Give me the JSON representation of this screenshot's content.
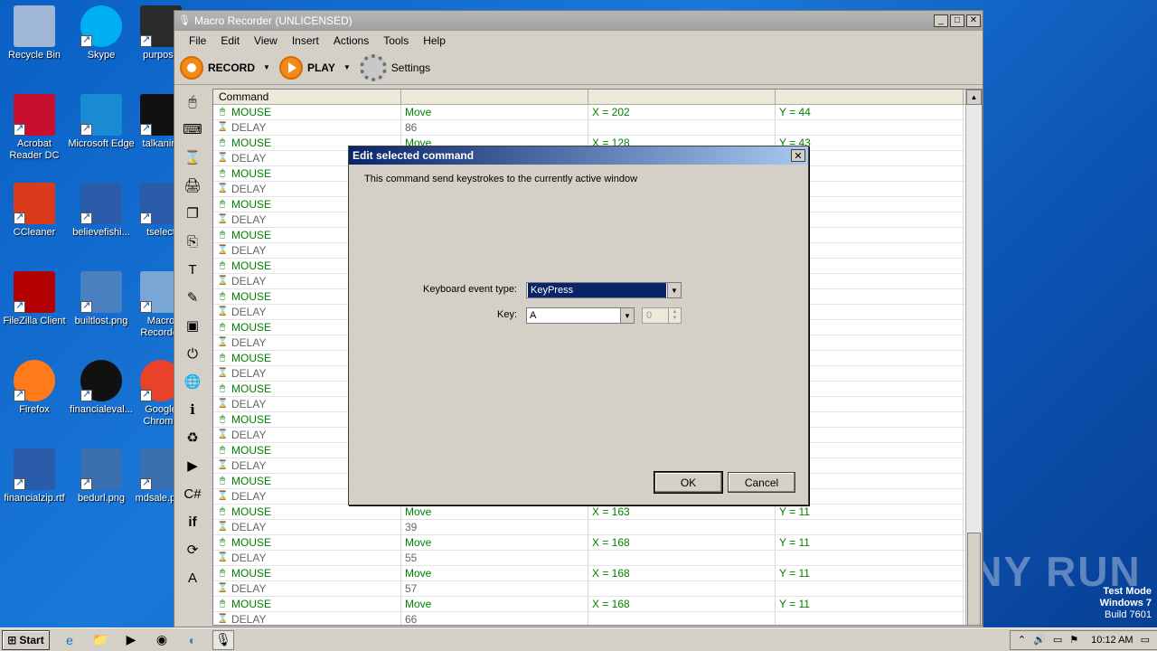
{
  "desktop_icons": [
    {
      "label": "Recycle Bin",
      "x": 0
    },
    {
      "label": "Skype"
    },
    {
      "label": "purpose"
    },
    {
      "label": "Acrobat Reader DC"
    },
    {
      "label": "Microsoft Edge"
    },
    {
      "label": "talkanim"
    },
    {
      "label": "CCleaner"
    },
    {
      "label": "believefishi..."
    },
    {
      "label": "tselect"
    },
    {
      "label": "FileZilla Client"
    },
    {
      "label": "builtlost.png"
    },
    {
      "label": "Macro Recorder"
    },
    {
      "label": "Firefox"
    },
    {
      "label": "financialeval..."
    },
    {
      "label": "Google Chrome"
    },
    {
      "label": "financialzip.rtf"
    },
    {
      "label": "bedurl.png"
    },
    {
      "label": "mdsale.png"
    }
  ],
  "window": {
    "title": "Macro Recorder (UNLICENSED)",
    "menu": [
      "File",
      "Edit",
      "View",
      "Insert",
      "Actions",
      "Tools",
      "Help"
    ],
    "toolbar": {
      "record": "RECORD",
      "play": "PLAY",
      "settings": "Settings"
    }
  },
  "table": {
    "headers": [
      "Command",
      "",
      "",
      ""
    ],
    "rows": [
      {
        "cmd": "MOUSE",
        "a": "Move",
        "b": "X = 202",
        "c": "Y = 44"
      },
      {
        "cmd": "DELAY",
        "a": "86",
        "b": "",
        "c": ""
      },
      {
        "cmd": "MOUSE",
        "a": "Move",
        "b": "X = 128",
        "c": "Y = 43"
      },
      {
        "cmd": "DELAY",
        "a": "",
        "b": "",
        "c": ""
      },
      {
        "cmd": "MOUSE",
        "a": "",
        "b": "",
        "c": ""
      },
      {
        "cmd": "DELAY",
        "a": "",
        "b": "",
        "c": ""
      },
      {
        "cmd": "MOUSE",
        "a": "",
        "b": "",
        "c": ""
      },
      {
        "cmd": "DELAY",
        "a": "",
        "b": "",
        "c": ""
      },
      {
        "cmd": "MOUSE",
        "a": "",
        "b": "",
        "c": ""
      },
      {
        "cmd": "DELAY",
        "a": "",
        "b": "",
        "c": ""
      },
      {
        "cmd": "MOUSE",
        "a": "",
        "b": "",
        "c": ""
      },
      {
        "cmd": "DELAY",
        "a": "",
        "b": "",
        "c": ""
      },
      {
        "cmd": "MOUSE",
        "a": "",
        "b": "",
        "c": ""
      },
      {
        "cmd": "DELAY",
        "a": "",
        "b": "",
        "c": ""
      },
      {
        "cmd": "MOUSE",
        "a": "",
        "b": "",
        "c": ""
      },
      {
        "cmd": "DELAY",
        "a": "",
        "b": "",
        "c": ""
      },
      {
        "cmd": "MOUSE",
        "a": "",
        "b": "",
        "c": ""
      },
      {
        "cmd": "DELAY",
        "a": "",
        "b": "",
        "c": ""
      },
      {
        "cmd": "MOUSE",
        "a": "",
        "b": "",
        "c": ""
      },
      {
        "cmd": "DELAY",
        "a": "",
        "b": "",
        "c": ""
      },
      {
        "cmd": "MOUSE",
        "a": "",
        "b": "",
        "c": ""
      },
      {
        "cmd": "DELAY",
        "a": "",
        "b": "",
        "c": ""
      },
      {
        "cmd": "MOUSE",
        "a": "",
        "b": "",
        "c": ""
      },
      {
        "cmd": "DELAY",
        "a": "",
        "b": "",
        "c": ""
      },
      {
        "cmd": "MOUSE",
        "a": "",
        "b": "",
        "c": ""
      },
      {
        "cmd": "DELAY",
        "a": "",
        "b": "",
        "c": ""
      },
      {
        "cmd": "MOUSE",
        "a": "Move",
        "b": "X = 163",
        "c": "Y = 11"
      },
      {
        "cmd": "DELAY",
        "a": "39",
        "b": "",
        "c": ""
      },
      {
        "cmd": "MOUSE",
        "a": "Move",
        "b": "X = 168",
        "c": "Y = 11"
      },
      {
        "cmd": "DELAY",
        "a": "55",
        "b": "",
        "c": ""
      },
      {
        "cmd": "MOUSE",
        "a": "Move",
        "b": "X = 168",
        "c": "Y = 11"
      },
      {
        "cmd": "DELAY",
        "a": "57",
        "b": "",
        "c": ""
      },
      {
        "cmd": "MOUSE",
        "a": "Move",
        "b": "X = 168",
        "c": "Y = 11"
      },
      {
        "cmd": "DELAY",
        "a": "66",
        "b": "",
        "c": ""
      }
    ]
  },
  "dialog": {
    "title": "Edit selected command",
    "description": "This command send keystrokes to the currently active window",
    "event_type_label": "Keyboard event type:",
    "event_type_value": "KeyPress",
    "key_label": "Key:",
    "key_value": "A",
    "count_value": "0",
    "ok": "OK",
    "cancel": "Cancel"
  },
  "taskbar": {
    "start": "Start",
    "clock": "10:12 AM"
  },
  "watermark": {
    "line1": "Test Mode",
    "line2": "Windows 7",
    "line3": "Build 7601",
    "brand": "ANY RUN"
  }
}
